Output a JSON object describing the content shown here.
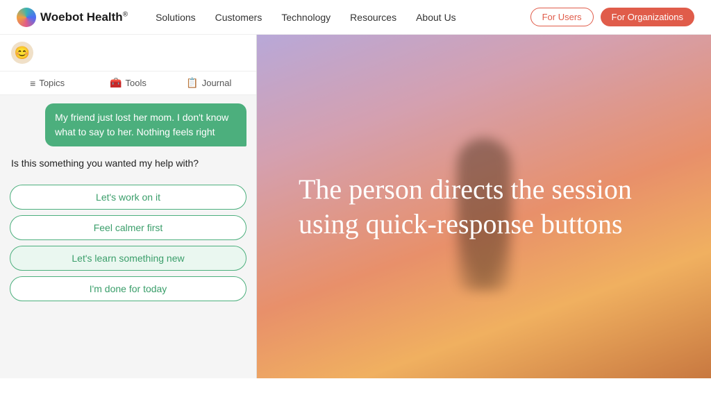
{
  "navbar": {
    "logo_text": "Woebot Health",
    "logo_sup": "®",
    "nav_links": [
      {
        "label": "Solutions",
        "id": "solutions"
      },
      {
        "label": "Customers",
        "id": "customers"
      },
      {
        "label": "Technology",
        "id": "technology"
      },
      {
        "label": "Resources",
        "id": "resources"
      },
      {
        "label": "About Us",
        "id": "about-us"
      }
    ],
    "btn_users_label": "For Users",
    "btn_orgs_label": "For Organizations"
  },
  "chat": {
    "avatar_emoji": "😊",
    "tabs": [
      {
        "label": "Topics",
        "icon": "≡"
      },
      {
        "label": "Tools",
        "icon": "🧰"
      },
      {
        "label": "Journal",
        "icon": "📋"
      }
    ],
    "user_message": "My friend just lost her mom. I don't know what to say to her. Nothing feels right",
    "bot_question": "Is this something you wanted my help with?",
    "quick_replies": [
      {
        "label": "Let's work on it"
      },
      {
        "label": "Feel calmer first"
      },
      {
        "label": "Let's learn something new"
      },
      {
        "label": "I'm done for today"
      }
    ]
  },
  "hero": {
    "heading": "The person directs the session using quick-response buttons"
  }
}
